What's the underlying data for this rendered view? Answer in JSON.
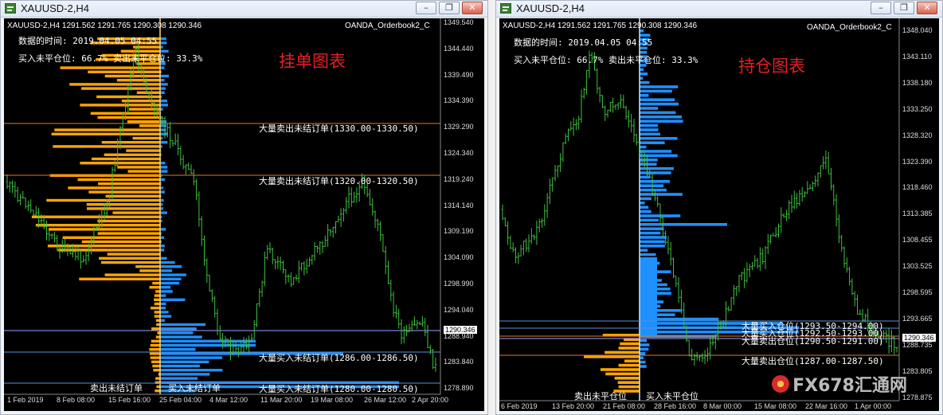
{
  "left_window": {
    "title": "XAUUSD-2,H4",
    "symbol_line": "XAUUSD-2,H4  1291.562 1291.765 1290.308 1290.346",
    "indicator_name": "OANDA_Orderbook2_C",
    "info_time": "数据的时间: 2019.04.05 04:55",
    "info_ratio": "买入未平仓位: 66.7%  卖出未平仓位: 33.3%",
    "chart_title": "挂单图表",
    "annotations": [
      "大量卖出未结订单(1330.00-1330.50)",
      "大量卖出未结订单(1320.00-1320.50)",
      "大量买入未结订单(1286.00-1286.50)",
      "大量买入未结订单(1280.00-1280.50)"
    ],
    "bottom_label_left": "卖出未结订单",
    "bottom_label_right": "买入未结订单",
    "current_price": "1290.346",
    "y_ticks": [
      "1349.540",
      "1344.440",
      "1339.490",
      "1334.390",
      "1329.290",
      "1324.340",
      "1319.240",
      "1314.140",
      "1309.190",
      "1304.090",
      "1298.990",
      "1294.040",
      "1288.940",
      "1283.840",
      "1278.890"
    ],
    "x_ticks": [
      "1 Feb 2019",
      "8 Feb 08:00",
      "15 Feb 16:00",
      "25 Feb 04:00",
      "4 Mar 12:00",
      "11 Mar 20:00",
      "19 Mar 08:00",
      "26 Mar 12:00",
      "2 Apr 20:00"
    ]
  },
  "right_window": {
    "title": "XAUUSD-2,H4",
    "symbol_line": "XAUUSD-2,H4  1291.562 1291.765 1290.308 1290.346",
    "indicator_name": "OANDA_Orderbook2_C",
    "info_time": "数据的时间: 2019.04.05 04:55",
    "info_ratio": "买入未平仓位: 66.7%  卖出未平仓位: 33.3%",
    "chart_title": "持仓图表",
    "annotations": [
      "大量买入仓位(1293.50-1294.00)",
      "大量买入仓位(1292.50-1293.00)",
      "大量卖出仓位(1290.50-1291.00)",
      "大量卖出仓位(1287.00-1287.50)"
    ],
    "bottom_label_left": "卖出未平仓位",
    "bottom_label_right": "买入未平仓位",
    "current_price": "1290.346",
    "y_ticks": [
      "1348.040",
      "1343.110",
      "1338.180",
      "1333.250",
      "1328.320",
      "1323.390",
      "1318.460",
      "1313.385",
      "1308.455",
      "1303.525",
      "1298.595",
      "1293.665",
      "1288.735",
      "1283.805",
      "1278.875"
    ],
    "x_ticks": [
      "6 Feb 2019",
      "13 Feb 20:00",
      "21 Feb 08:00",
      "28 Feb 16:00",
      "8 Mar 00:00",
      "15 Mar 08:00",
      "22 Mar 16:00",
      "1 Apr 00:00"
    ]
  },
  "watermark": "FX678汇通网",
  "colors": {
    "candle": "#3fbf3f",
    "sell_orders": "#ffa500",
    "buy_orders": "#1e90ff",
    "chart_title": "#e32020",
    "sell_level_line": "#e07a2f",
    "buy_level_line": "#5b8fd8"
  }
}
